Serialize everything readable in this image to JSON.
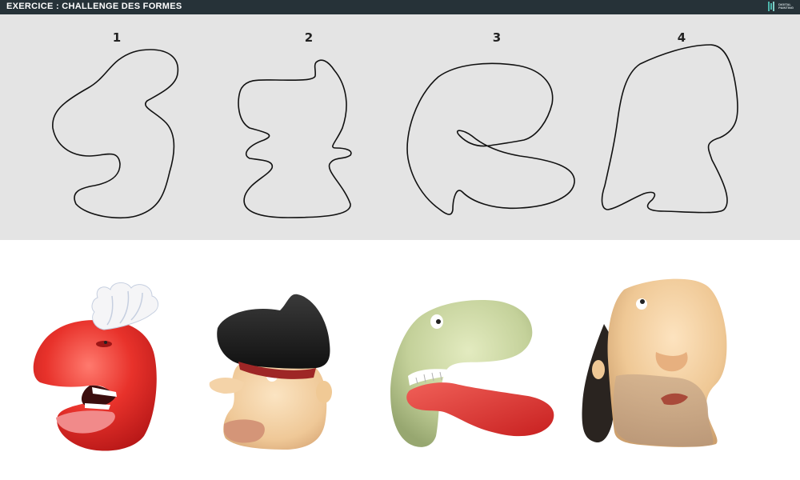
{
  "header": {
    "title": "EXERCICE : CHALLENGE DES FORMES",
    "brand_line1": "DIGITAL",
    "brand_line2": "PAINTING",
    "background": "#263238"
  },
  "exercise": {
    "panel_color": "#e4e4e4",
    "shapes": [
      {
        "number": "1"
      },
      {
        "number": "2"
      },
      {
        "number": "3"
      },
      {
        "number": "4"
      }
    ]
  },
  "characters": [
    {
      "name": "red-chef-head",
      "skin": "#e8342e",
      "accessory": "chef hat"
    },
    {
      "name": "pirate-head",
      "skin": "#f0d3a8",
      "accessory": "black hat"
    },
    {
      "name": "green-creature-head",
      "skin": "#c9d59e",
      "accessory": "red tongue"
    },
    {
      "name": "bald-bearded-head",
      "skin": "#f1cfa2",
      "accessory": "long dark hair"
    }
  ]
}
